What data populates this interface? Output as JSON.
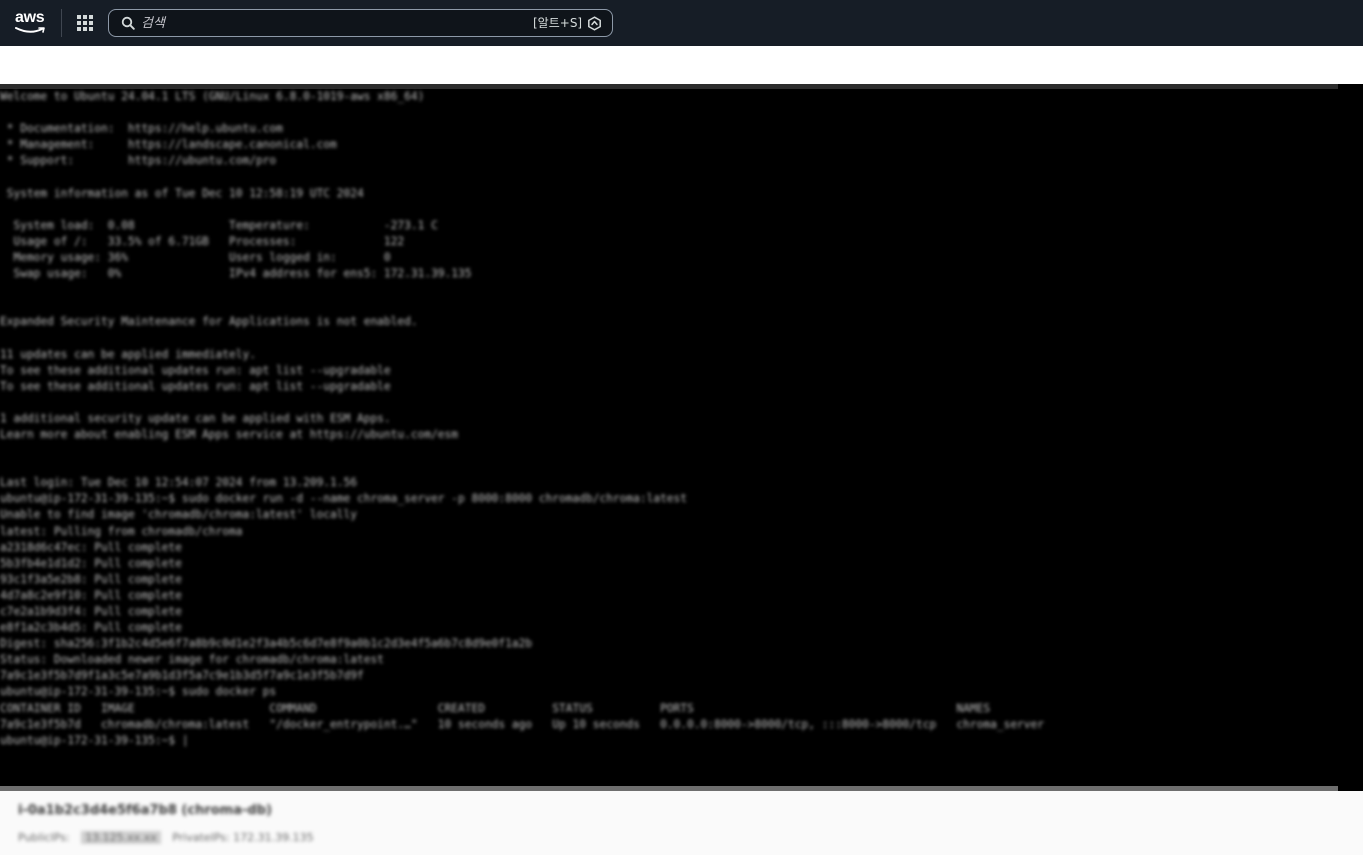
{
  "topbar": {
    "logo_text": "aws",
    "search": {
      "placeholder": "검색",
      "value": "",
      "shortcut": "[알트+S]"
    },
    "icons": {
      "apps": "grid-icon",
      "search": "search-icon",
      "shortcut": "command-icon"
    },
    "colors": {
      "background": "#161d26",
      "logo_smile": "#ff9900"
    }
  },
  "terminal": {
    "lines": [
      "Welcome to Ubuntu 24.04.1 LTS (GNU/Linux 6.8.0-1019-aws x86_64)",
      "",
      " * Documentation:  https://help.ubuntu.com",
      " * Management:     https://landscape.canonical.com",
      " * Support:        https://ubuntu.com/pro",
      "",
      " System information as of Tue Dec 10 12:58:19 UTC 2024",
      "",
      "  System load:  0.08              Temperature:           -273.1 C",
      "  Usage of /:   33.5% of 6.71GB   Processes:             122",
      "  Memory usage: 36%               Users logged in:       0",
      "  Swap usage:   0%                IPv4 address for ens5: 172.31.39.135",
      "",
      "",
      "Expanded Security Maintenance for Applications is not enabled.",
      "",
      "11 updates can be applied immediately.",
      "To see these additional updates run: apt list --upgradable",
      "To see these additional updates run: apt list --upgradable",
      "",
      "1 additional security update can be applied with ESM Apps.",
      "Learn more about enabling ESM Apps service at https://ubuntu.com/esm",
      "",
      "",
      "Last login: Tue Dec 10 12:54:07 2024 from 13.209.1.56",
      "ubuntu@ip-172-31-39-135:~$ sudo docker run -d --name chroma_server -p 8000:8000 chromadb/chroma:latest",
      "Unable to find image 'chromadb/chroma:latest' locally",
      "latest: Pulling from chromadb/chroma",
      "a2318d6c47ec: Pull complete",
      "5b3fb4e1d1d2: Pull complete",
      "93c1f3a5e2b8: Pull complete",
      "4d7a8c2e9f10: Pull complete",
      "c7e2a1b9d3f4: Pull complete",
      "e8f1a2c3b4d5: Pull complete",
      "Digest: sha256:3f1b2c4d5e6f7a8b9c0d1e2f3a4b5c6d7e8f9a0b1c2d3e4f5a6b7c8d9e0f1a2b",
      "Status: Downloaded newer image for chromadb/chroma:latest",
      "7a9c1e3f5b7d9f1a3c5e7a9b1d3f5a7c9e1b3d5f7a9c1e3f5b7d9f",
      "ubuntu@ip-172-31-39-135:~$ sudo docker ps",
      "CONTAINER ID   IMAGE                    COMMAND                  CREATED          STATUS          PORTS                                       NAMES",
      "7a9c1e3f5b7d   chromadb/chroma:latest   \"/docker_entrypoint.…\"   10 seconds ago   Up 10 seconds   0.0.0.0:8000->8000/tcp, :::8000->8000/tcp   chroma_server",
      "ubuntu@ip-172-31-39-135:~$ |"
    ]
  },
  "footer": {
    "title": "i-0a1b2c3d4e5f6a7b8 (chroma-db)",
    "detail_prefix": "PublicIPs:",
    "detail_highlight": "13.125.xx.xx",
    "detail_suffix": "PrivateIPs: 172.31.39.135"
  }
}
